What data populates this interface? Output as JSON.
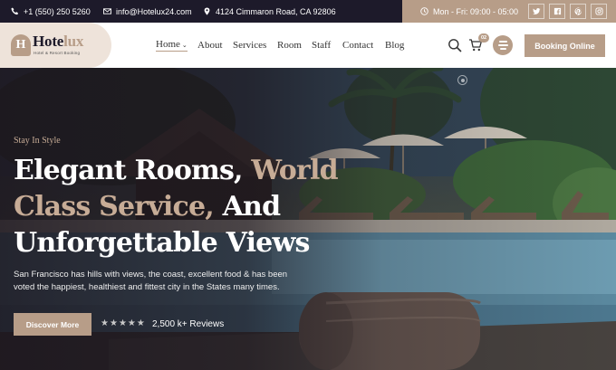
{
  "topbar": {
    "phone": "+1 (550) 250 5260",
    "email": "info@Hotelux24.com",
    "address": "4124 Cimmaron Road, CA 92806",
    "hours": "Mon - Fri: 09:00 - 05:00",
    "socials": [
      "twitter-icon",
      "facebook-icon",
      "pinterest-icon",
      "instagram-icon"
    ]
  },
  "brand": {
    "name_part1": "Hote",
    "name_part2": "lux",
    "tagline": "Hotel & Resort Booking"
  },
  "nav": {
    "items": [
      "Home",
      "About",
      "Services",
      "Room",
      "Staff",
      "Contact",
      "Blog"
    ],
    "active": "Home"
  },
  "header": {
    "cart_count": "02",
    "booking_label": "Booking Online"
  },
  "hero": {
    "eyebrow": "Stay In Style",
    "headline_1": "Elegant Rooms, ",
    "headline_2": "World",
    "headline_3": "Class Service, ",
    "headline_4": "And",
    "headline_5": "Unforgettable Views",
    "description": "San Francisco has hills with views, the coast, excellent food & has been voted the happiest, healthiest and fittest city in the States many times.",
    "cta_label": "Discover More",
    "rating_stars": 5,
    "reviews": "2,500 k+ Reviews"
  },
  "colors": {
    "accent": "#b79d88",
    "dark": "#1d1a2a",
    "headline_accent": "#c7ac96"
  }
}
